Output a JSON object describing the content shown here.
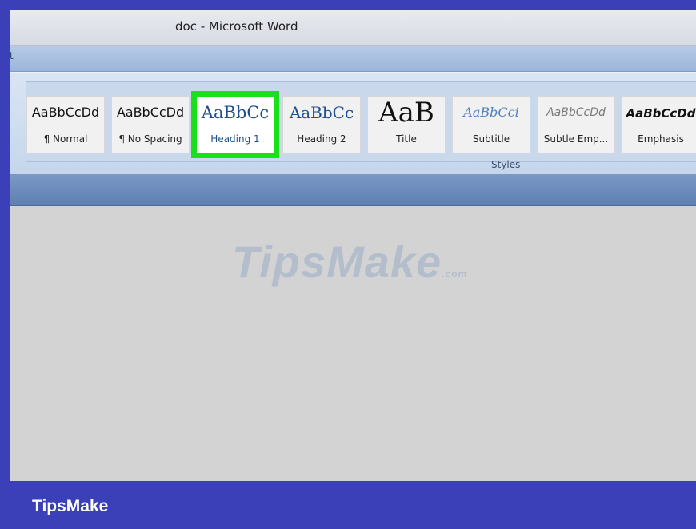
{
  "window": {
    "title": "doc - Microsoft Word"
  },
  "tabstrip": {
    "fragment": "t"
  },
  "styles_gallery": {
    "group_label": "Styles",
    "items": [
      {
        "preview": "AaBbCcDd",
        "name": "¶ Normal",
        "selected": false
      },
      {
        "preview": "AaBbCcDd",
        "name": "¶ No Spacing",
        "selected": false
      },
      {
        "preview": "AaBbCc",
        "name": "Heading 1",
        "selected": true
      },
      {
        "preview": "AaBbCc",
        "name": "Heading 2",
        "selected": false
      },
      {
        "preview": "AaB",
        "name": "Title",
        "selected": false
      },
      {
        "preview": "AaBbCci",
        "name": "Subtitle",
        "selected": false
      },
      {
        "preview": "AaBbCcDd",
        "name": "Subtle Emp...",
        "selected": false
      },
      {
        "preview": "AaBbCcDd",
        "name": "Emphasis",
        "selected": false
      }
    ]
  },
  "watermark": {
    "text": "TipsMake",
    "suffix": ".com"
  },
  "footer": {
    "brand": "TipsMake"
  },
  "colors": {
    "frame": "#3b3fb8",
    "highlight": "#19e019",
    "ribbon": "#c5d6ec"
  }
}
